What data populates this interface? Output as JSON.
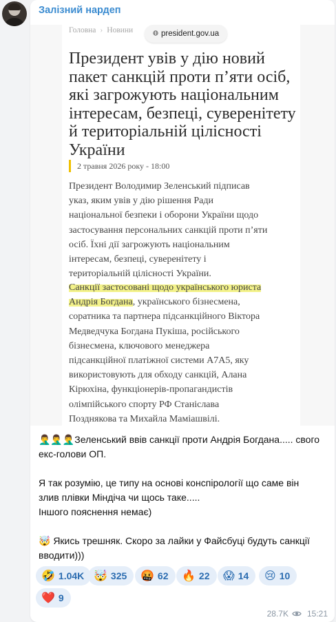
{
  "channel": {
    "name": "Залізний нардеп"
  },
  "article": {
    "breadcrumb": [
      "Головна",
      "Новини"
    ],
    "url": "president.gov.ua",
    "headline": [
      "Президент увів у дію новий",
      "пакет санкцій проти п’яти осіб,",
      "які загрожують національним",
      "інтересам, безпеці, суверенітету",
      "й територіальній цілісності",
      "України"
    ],
    "date": "2 травня 2026 року - 18:00",
    "paragraph1": [
      "Президент Володимир Зеленський підписав",
      "указ, яким увів у дію рішення Ради",
      "національної безпеки і оборони України щодо",
      "застосування персональних санкцій проти п’яти",
      "осіб. Їхні дії загрожують національним",
      "інтересам, безпеці, суверенітету і",
      "територіальній цілісності України."
    ],
    "paragraph2_highlight_1": "Санкції застосовані щодо українського юриста",
    "paragraph2_highlight_2": "Андрія Богдана",
    "paragraph2_rest_1": ", українського бізнесмена,",
    "paragraph2_lines": [
      "соратника та партнера підсанкційного Віктора",
      "Медведчука Богдана Пукіша, російського",
      "бізнесмена, ключового менеджера",
      "підсанкційної платіжної системи A7A5, яку",
      "використовують для обходу санкцій, Алана",
      "Кірюхіна, функціонерів-пропагандистів",
      "олімпійського спорту РФ Станіслава",
      "Позднякова та Михайла Маміашвілі."
    ]
  },
  "post": {
    "lines": [
      "🤦‍♂️🤦‍♂️🤦‍♂️Зеленський ввів санкції проти Андрія Богдана..... свого",
      "екс-голови ОП.",
      "",
      "Я так розумію, це типу на основі конспірології що саме він",
      "злив плівки Міндіча чи щось таке.....",
      "Іншого пояснення немає)",
      "",
      "🤯 Якись трешняк. Скоро за лайки у Файсбуці будуть санкції",
      "вводити)))"
    ]
  },
  "reactions": [
    {
      "emoji": "🤣",
      "count": "1.04K"
    },
    {
      "emoji": "🤯",
      "count": "325"
    },
    {
      "emoji": "🤬",
      "count": "62"
    },
    {
      "emoji": "🔥",
      "count": "22"
    },
    {
      "emoji": "😱",
      "count": "14"
    },
    {
      "emoji": "😢",
      "count": "10"
    },
    {
      "emoji": "❤️",
      "count": "9"
    }
  ],
  "meta": {
    "views": "28.7K",
    "time": "15:21"
  }
}
